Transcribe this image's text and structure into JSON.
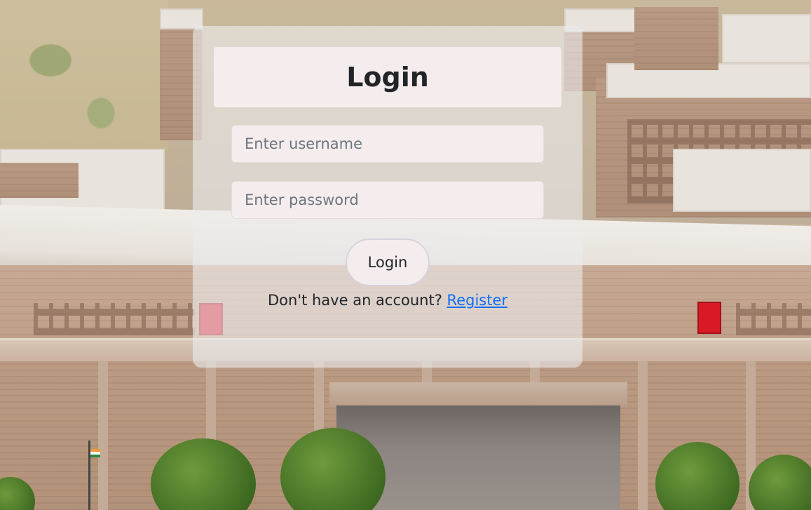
{
  "login_form": {
    "title": "Login",
    "username": {
      "placeholder": "Enter username",
      "value": ""
    },
    "password": {
      "placeholder": "Enter password",
      "value": ""
    },
    "submit_label": "Login",
    "register_prompt": "Don't have an account?",
    "register_link": "Register"
  },
  "colors": {
    "card_background": "#ebebee",
    "field_background": "#f5eded",
    "link": "#0d6efd",
    "text": "#212529"
  }
}
